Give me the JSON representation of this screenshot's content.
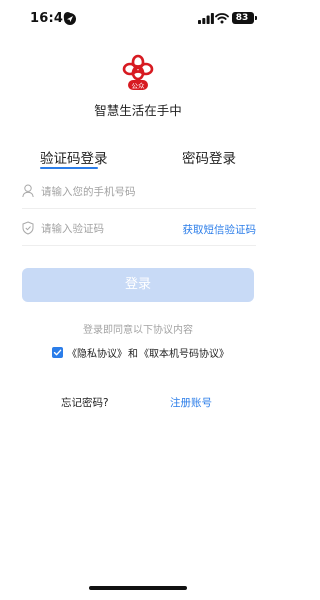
{
  "status_bar": {
    "time": "16:40",
    "battery": "83"
  },
  "app": {
    "logo_text": "公众",
    "title": "智慧生活在手中"
  },
  "tabs": [
    {
      "label": "验证码登录",
      "active": true
    },
    {
      "label": "密码登录",
      "active": false
    }
  ],
  "form": {
    "phone_placeholder": "请输入您的手机号码",
    "phone_value": "",
    "code_placeholder": "请输入验证码",
    "code_value": "",
    "get_code_label": "获取短信验证码",
    "login_label": "登录"
  },
  "agreement": {
    "hint": "登录即同意以下协议内容",
    "checked": true,
    "privacy_label": "《隐私协议》",
    "and_text": "和",
    "number_label": "《取本机号码协议》"
  },
  "links": {
    "forgot_label": "忘记密码?",
    "register_label": "注册账号"
  },
  "colors": {
    "accent": "#2b7de9",
    "button_disabled": "#c8daf6",
    "logo_red": "#d71a21"
  }
}
